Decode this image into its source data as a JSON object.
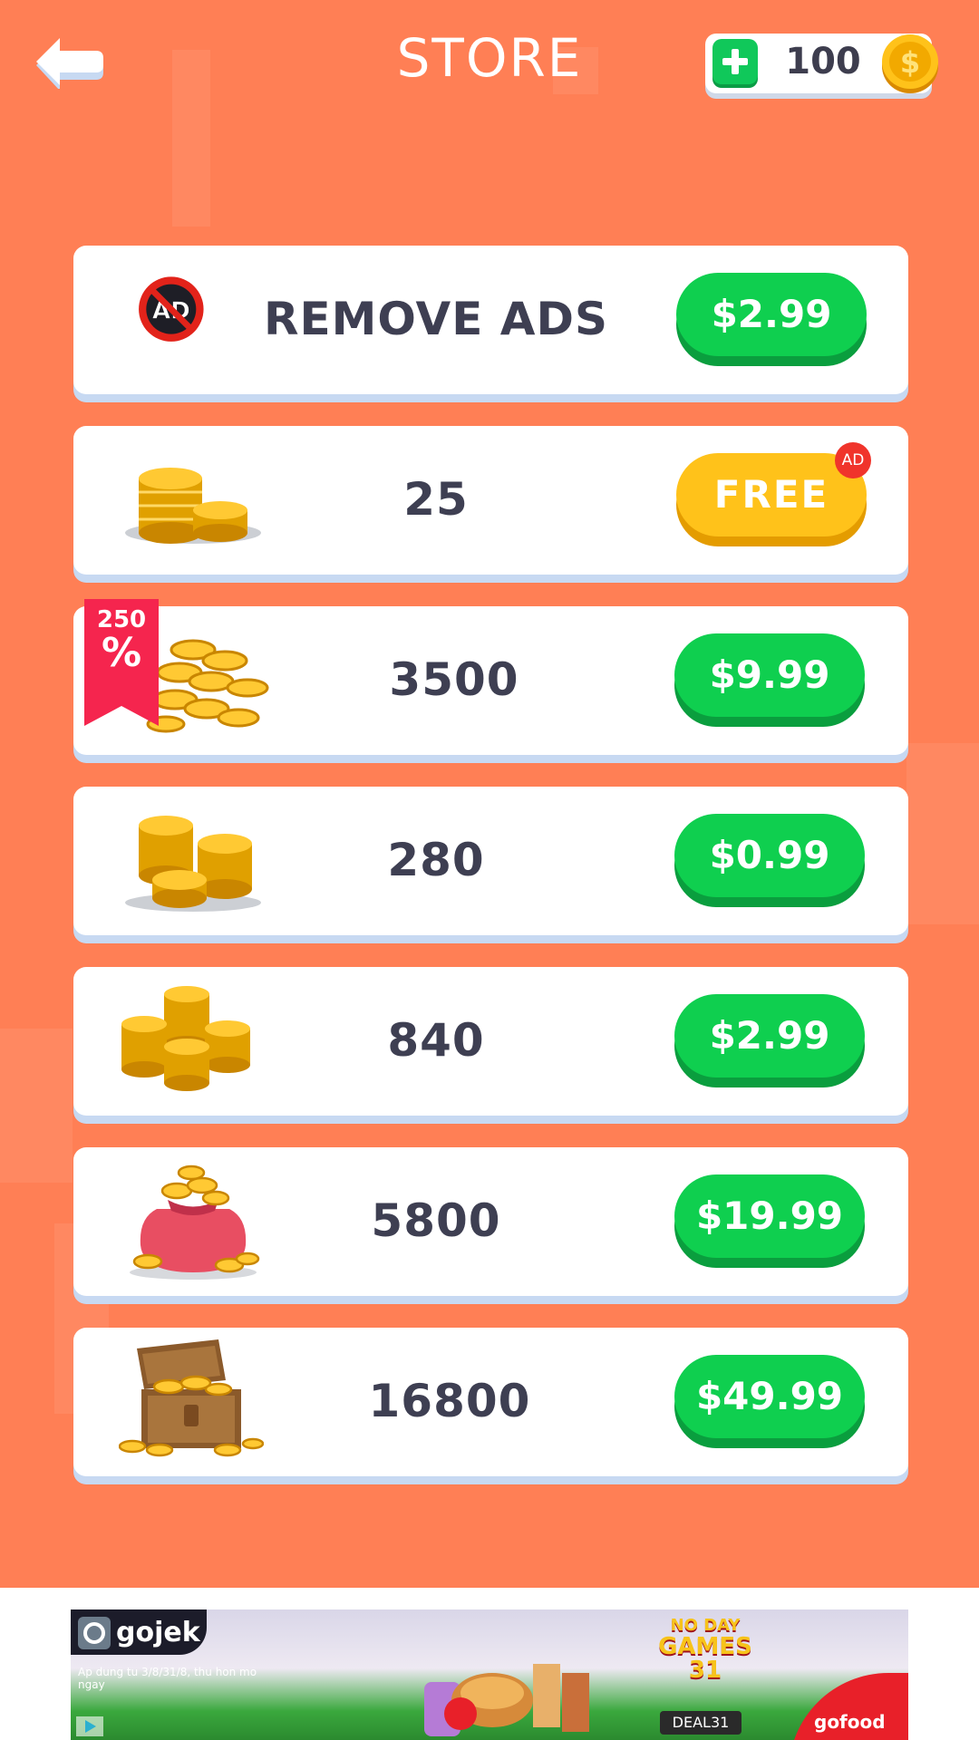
{
  "header": {
    "title": "STORE",
    "coins": "100"
  },
  "store_items": [
    {
      "label": "REMOVE ADS",
      "price": "$2.99",
      "icon": "remove-ads-icon"
    },
    {
      "label": "25",
      "price": "FREE",
      "icon": "coin-stack-icon",
      "badge": "AD"
    },
    {
      "label": "3500",
      "price": "$9.99",
      "icon": "coin-pile-icon",
      "ribbon_top": "250",
      "ribbon_bottom": "%"
    },
    {
      "label": "280",
      "price": "$0.99",
      "icon": "coin-stacks-icon"
    },
    {
      "label": "840",
      "price": "$2.99",
      "icon": "coin-stacks-large-icon"
    },
    {
      "label": "5800",
      "price": "$19.99",
      "icon": "coin-bag-icon"
    },
    {
      "label": "16800",
      "price": "$49.99",
      "icon": "treasure-chest-icon"
    }
  ],
  "banner": {
    "brand_logo": "gojek",
    "subtext": "Ap dung tu 3/8/31/8, thu hon mo ngay",
    "headline_1": "NO DAY",
    "headline_2": "GAMES",
    "headline_3": "31",
    "code": "DEAL31",
    "brand": "gofood"
  },
  "colors": {
    "background": "#FF7F55",
    "buy_green": "#0FCF4F",
    "free_yellow": "#FFC21A",
    "text_dark": "#3e3f52",
    "ribbon_red": "#F5254E"
  }
}
